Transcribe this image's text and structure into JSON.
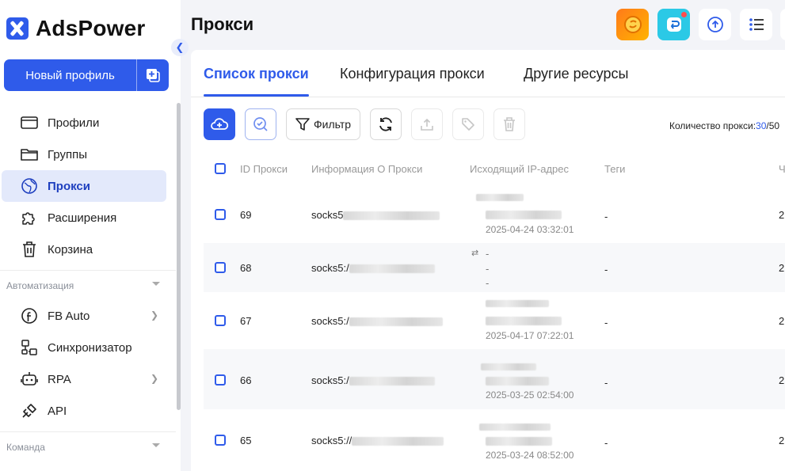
{
  "app": {
    "logo_text": "AdsPower",
    "page_title": "Прокси"
  },
  "sidebar": {
    "new_profile_label": "Новый профиль",
    "items": [
      {
        "label": "Профили",
        "icon": "profile-card-icon"
      },
      {
        "label": "Группы",
        "icon": "folder-icon"
      },
      {
        "label": "Прокси",
        "icon": "globe-pin-icon",
        "active": true
      },
      {
        "label": "Расширения",
        "icon": "puzzle-icon"
      },
      {
        "label": "Корзина",
        "icon": "trash-icon"
      }
    ],
    "section_automation": "Автоматизация",
    "automation_items": [
      {
        "label": "FB Auto",
        "icon": "facebook-icon",
        "has_submenu": true
      },
      {
        "label": "Синхронизатор",
        "icon": "sync-nodes-icon",
        "has_submenu": false
      },
      {
        "label": "RPA",
        "icon": "robot-icon",
        "has_submenu": true
      },
      {
        "label": "API",
        "icon": "plug-icon",
        "has_submenu": false
      }
    ],
    "section_team": "Команда"
  },
  "tabs": [
    {
      "label": "Список прокси",
      "active": true
    },
    {
      "label": "Конфигурация прокси",
      "active": false
    },
    {
      "label": "Другие ресурсы",
      "active": false
    }
  ],
  "toolbar": {
    "filter_label": "Фильтр",
    "count_label": "Количество прокси:",
    "count_value": "30",
    "count_total": "/50"
  },
  "table": {
    "headers": [
      "ID Прокси",
      "Информация О Прокси",
      "Исходящий IP-адрес",
      "Теги",
      "Ч"
    ],
    "rows": [
      {
        "id": "69",
        "info": "socks5",
        "ip_time": "2025-04-24 03:32:01",
        "tags": "-",
        "last": "2"
      },
      {
        "id": "68",
        "info": "socks5:/",
        "ip_time": "",
        "ip_lines": [
          "-",
          "-",
          "-"
        ],
        "tags": "-",
        "last": "2"
      },
      {
        "id": "67",
        "info": "socks5:/",
        "ip_time": "2025-04-17 07:22:01",
        "tags": "-",
        "last": "2"
      },
      {
        "id": "66",
        "info": "socks5:/",
        "ip_time": "2025-03-25 02:54:00",
        "tags": "-",
        "last": "2"
      },
      {
        "id": "65",
        "info": "socks5://",
        "ip_time": "2025-03-24 08:52:00",
        "tags": "-",
        "last": "2"
      }
    ]
  },
  "colors": {
    "accent": "#2f5bea",
    "active_nav_bg": "#e3e9fb"
  }
}
